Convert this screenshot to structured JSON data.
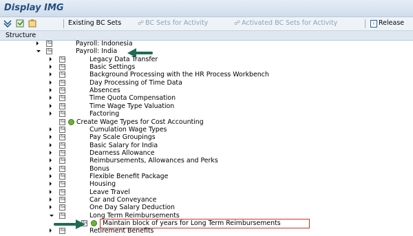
{
  "window": {
    "title": "Display IMG"
  },
  "toolbar": {
    "existing_bc_sets": "Existing BC Sets",
    "bc_sets_for_activity": "BC Sets for Activity",
    "activated_bc_sets": "Activated BC Sets for Activity",
    "release": "Release"
  },
  "structure": {
    "header": "Structure",
    "items": [
      {
        "label": "Payroll: Indonesia",
        "level": 0,
        "state": "collapsed"
      },
      {
        "label": "Payroll: India",
        "level": 0,
        "state": "expanded"
      },
      {
        "label": "Legacy Data Transfer",
        "level": 1,
        "state": "collapsed"
      },
      {
        "label": "Basic Settings",
        "level": 1,
        "state": "collapsed"
      },
      {
        "label": "Background Processing with the HR Process Workbench",
        "level": 1,
        "state": "collapsed"
      },
      {
        "label": "Day Processing of Time Data",
        "level": 1,
        "state": "collapsed"
      },
      {
        "label": "Absences",
        "level": 1,
        "state": "collapsed"
      },
      {
        "label": "Time Quota Compensation",
        "level": 1,
        "state": "collapsed"
      },
      {
        "label": "Time Wage Type Valuation",
        "level": 1,
        "state": "collapsed"
      },
      {
        "label": "Factoring",
        "level": 1,
        "state": "collapsed"
      },
      {
        "label": "Create Wage Types for Cost Accounting",
        "level": 1,
        "state": "leaf"
      },
      {
        "label": "Cumulation Wage Types",
        "level": 1,
        "state": "collapsed"
      },
      {
        "label": "Pay Scale Groupings",
        "level": 1,
        "state": "collapsed"
      },
      {
        "label": "Basic Salary for India",
        "level": 1,
        "state": "collapsed"
      },
      {
        "label": "Dearness Allowance",
        "level": 1,
        "state": "collapsed"
      },
      {
        "label": "Reimbursements, Allowances and Perks",
        "level": 1,
        "state": "collapsed"
      },
      {
        "label": "Bonus",
        "level": 1,
        "state": "collapsed"
      },
      {
        "label": "Flexible Benefit Package",
        "level": 1,
        "state": "collapsed"
      },
      {
        "label": "Housing",
        "level": 1,
        "state": "collapsed"
      },
      {
        "label": "Leave Travel",
        "level": 1,
        "state": "collapsed"
      },
      {
        "label": "Car and Conveyance",
        "level": 1,
        "state": "collapsed"
      },
      {
        "label": "One Day Salary Deduction",
        "level": 1,
        "state": "collapsed"
      },
      {
        "label": "Long Term Reimbursements",
        "level": 1,
        "state": "expanded"
      },
      {
        "label": "Maintain block of years for Long Term Reimbursements",
        "level": 2,
        "state": "leaf",
        "highlighted": true
      },
      {
        "label": "Retirement Benefits",
        "level": 1,
        "state": "collapsed"
      }
    ]
  },
  "icons": {
    "collapsed": "triangle-right-icon",
    "expanded": "triangle-down-icon",
    "node": "img-document-icon",
    "activity": "execute-clock-icon",
    "pointer": "green-arrow-pointer-icon"
  },
  "colors": {
    "title": "#23507e",
    "highlight_border": "#d2302c",
    "pointer": "#1f6b54"
  }
}
